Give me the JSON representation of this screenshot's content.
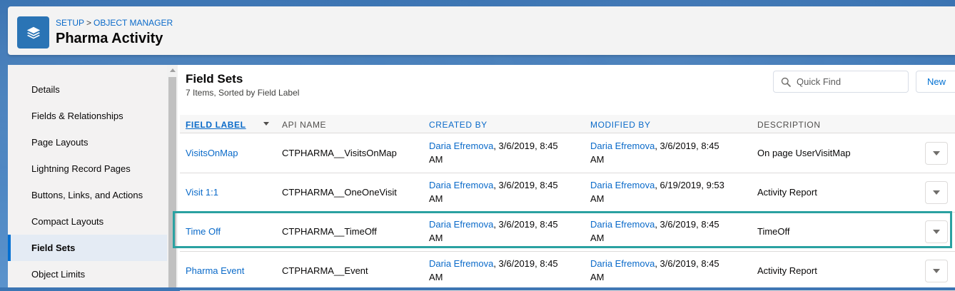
{
  "header": {
    "breadcrumb": [
      "SETUP",
      "OBJECT MANAGER"
    ],
    "breadcrumb_separator": ">",
    "title": "Pharma Activity",
    "icon": "layers-icon"
  },
  "sidebar": {
    "items": [
      {
        "label": "Details",
        "active": false
      },
      {
        "label": "Fields & Relationships",
        "active": false
      },
      {
        "label": "Page Layouts",
        "active": false
      },
      {
        "label": "Lightning Record Pages",
        "active": false
      },
      {
        "label": "Buttons, Links, and Actions",
        "active": false
      },
      {
        "label": "Compact Layouts",
        "active": false
      },
      {
        "label": "Field Sets",
        "active": true
      },
      {
        "label": "Object Limits",
        "active": false
      }
    ]
  },
  "main": {
    "title": "Field Sets",
    "subtitle": "7 Items, Sorted by Field Label",
    "search": {
      "placeholder": "Quick Find",
      "value": ""
    },
    "new_button_label": "New",
    "table": {
      "columns": [
        "FIELD LABEL",
        "API NAME",
        "CREATED BY",
        "MODIFIED BY",
        "DESCRIPTION"
      ],
      "sorted_column": "FIELD LABEL",
      "rows": [
        {
          "label": "VisitsOnMap",
          "api_name": "CTPHARMA__VisitsOnMap",
          "created_by": "Daria Efremova",
          "created_at": ", 3/6/2019, 8:45",
          "created_at2": "AM",
          "modified_by": "Daria Efremova",
          "modified_at": ", 3/6/2019, 8:45",
          "modified_at2": "AM",
          "description": "On page UserVisitMap"
        },
        {
          "label": "Visit 1:1",
          "api_name": "CTPHARMA__OneOneVisit",
          "created_by": "Daria Efremova",
          "created_at": ", 3/6/2019, 8:45",
          "created_at2": "AM",
          "modified_by": "Daria Efremova",
          "modified_at": ", 6/19/2019, 9:53",
          "modified_at2": "AM",
          "description": "Activity Report"
        },
        {
          "label": "Time Off",
          "api_name": "CTPHARMA__TimeOff",
          "created_by": "Daria Efremova",
          "created_at": ", 3/6/2019, 8:45",
          "created_at2": "AM",
          "modified_by": "Daria Efremova",
          "modified_at": ", 3/6/2019, 8:45",
          "modified_at2": "AM",
          "description": "TimeOff"
        },
        {
          "label": "Pharma Event",
          "api_name": "CTPHARMA__Event",
          "created_by": "Daria Efremova",
          "created_at": ", 3/6/2019, 8:45",
          "created_at2": "AM",
          "modified_by": "Daria Efremova",
          "modified_at": ", 3/6/2019, 8:45",
          "modified_at2": "AM",
          "description": "Activity Report"
        }
      ]
    }
  },
  "colors": {
    "link": "#0a6ac9",
    "highlight": "#2aa1a1",
    "active_bar": "#0070d2"
  }
}
